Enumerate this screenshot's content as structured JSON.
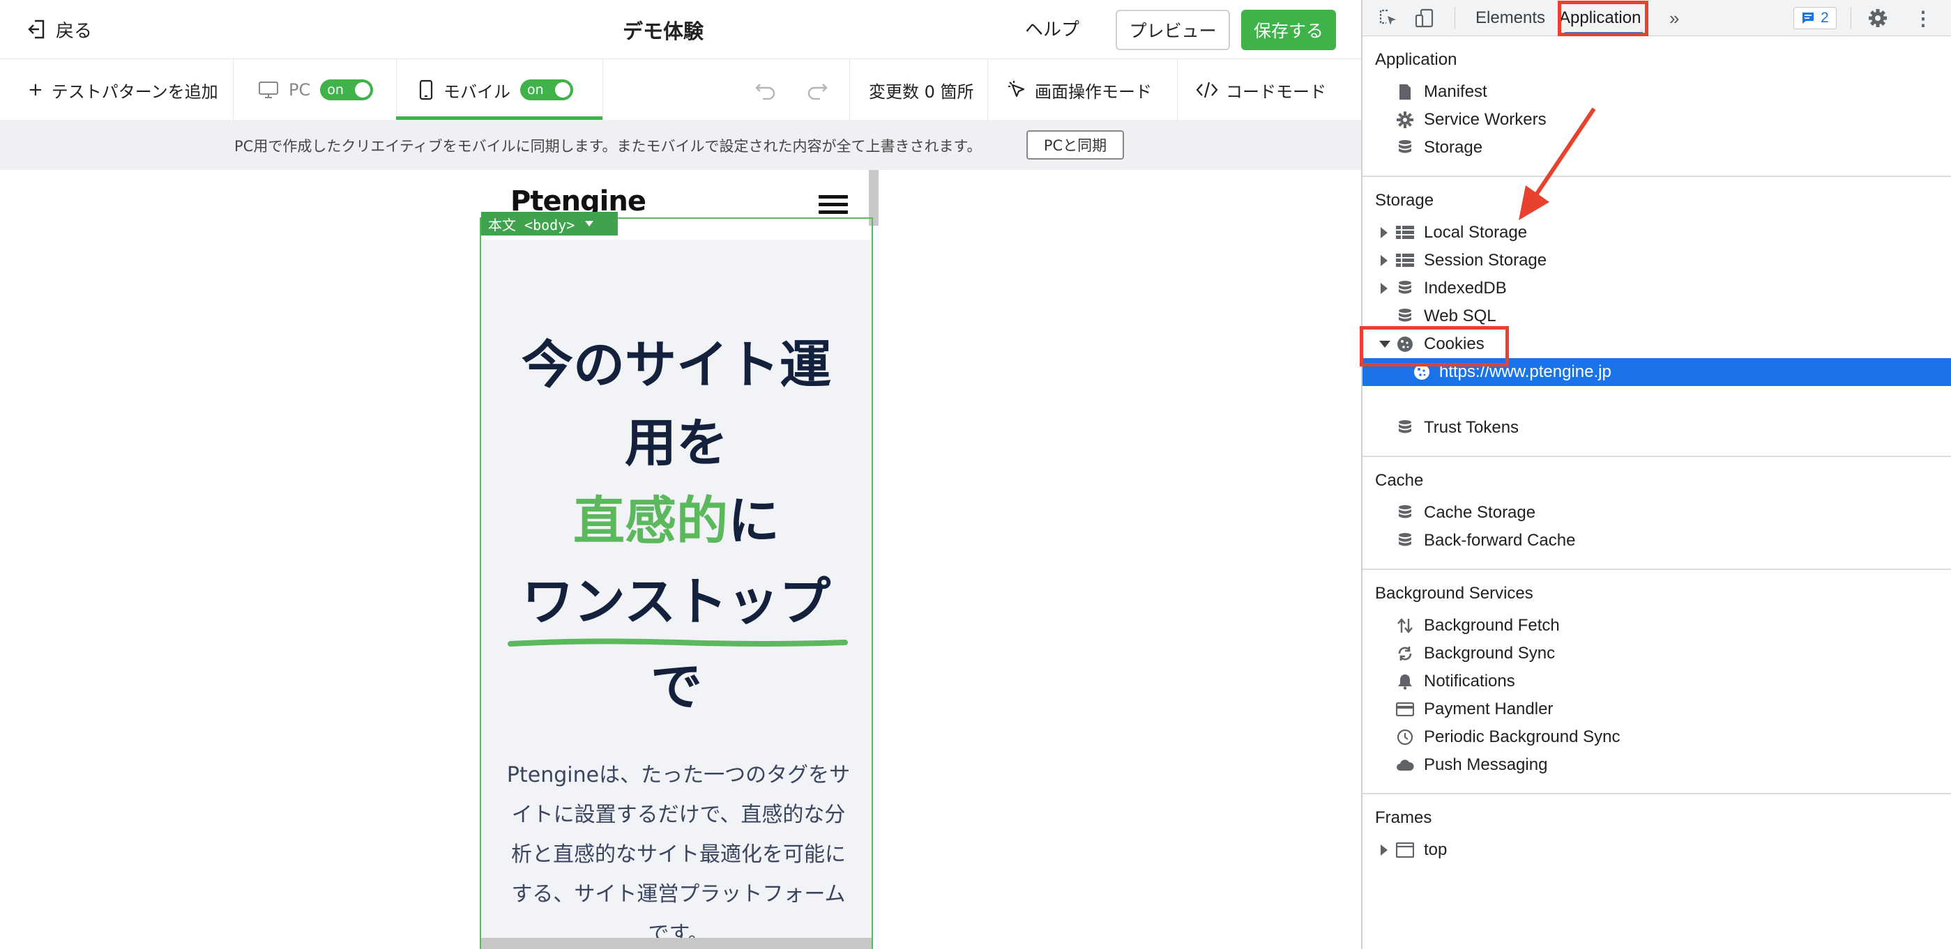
{
  "topbar": {
    "back_label": "戻る",
    "title": "デモ体験",
    "help_label": "ヘルプ",
    "preview_label": "プレビュー",
    "save_label": "保存する"
  },
  "toolbar": {
    "add_pattern_label": "テストパターンを追加",
    "pc_label": "PC",
    "pc_toggle": "on",
    "mobile_label": "モバイル",
    "mobile_toggle": "on",
    "change_count_label": "変更数 0 箇所",
    "screen_mode_label": "画面操作モード",
    "code_mode_label": "コードモード"
  },
  "sync_bar": {
    "message": "PC用で作成したクリエイティブをモバイルに同期します。またモバイルで設定された内容が全て上書きされます。",
    "sync_button": "PCと同期"
  },
  "mobile_preview": {
    "logo": "Ptengine",
    "selection_label": "本文 <body>",
    "hero_line1": "今のサイト運",
    "hero_line2": "用を",
    "hero_line3_green": "直感的",
    "hero_line3_rest": "に",
    "hero_line4": "ワンストップ",
    "hero_line5": "で",
    "description": "Ptengineは、たった一つのタグをサイトに設置するだけで、直感的な分析と直感的なサイト最適化を可能にする、サイト運営プラットフォームです。"
  },
  "devtools": {
    "tabs": {
      "elements": "Elements",
      "application": "Application",
      "more": "»"
    },
    "issues_count": "2",
    "sections": {
      "application": {
        "heading": "Application",
        "items": [
          "Manifest",
          "Service Workers",
          "Storage"
        ]
      },
      "storage": {
        "heading": "Storage",
        "items": [
          "Local Storage",
          "Session Storage",
          "IndexedDB",
          "Web SQL",
          "Cookies",
          "https://www.ptengine.jp",
          "Trust Tokens"
        ]
      },
      "cache": {
        "heading": "Cache",
        "items": [
          "Cache Storage",
          "Back-forward Cache"
        ]
      },
      "background_services": {
        "heading": "Background Services",
        "items": [
          "Background Fetch",
          "Background Sync",
          "Notifications",
          "Payment Handler",
          "Periodic Background Sync",
          "Push Messaging"
        ]
      },
      "frames": {
        "heading": "Frames",
        "items": [
          "top"
        ]
      }
    }
  },
  "colors": {
    "accent_green": "#3fb24a",
    "highlight_red": "#e8422e",
    "selection_blue": "#1a73e8",
    "hero_navy": "#14213d"
  }
}
